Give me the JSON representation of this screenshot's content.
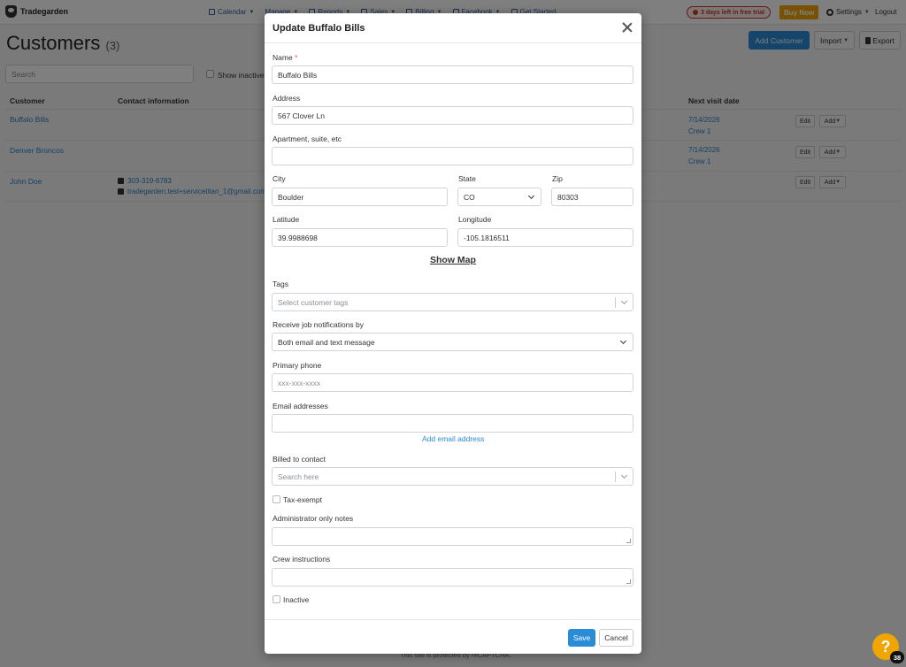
{
  "app": {
    "brand": "Tradegarden",
    "nav": [
      {
        "label": "Calendar"
      },
      {
        "label": "Manage"
      },
      {
        "label": "Reports"
      },
      {
        "label": "Sales"
      },
      {
        "label": "Billing"
      },
      {
        "label": "Facebook"
      },
      {
        "label": "Get Started"
      }
    ],
    "trial_badge": "3 days left in free trial",
    "buy_now": "Buy Now",
    "settings": "Settings",
    "logout": "Logout"
  },
  "page": {
    "title": "Customers",
    "count": "(3)",
    "add_customer": "Add Customer",
    "import": "Import",
    "export": "Export",
    "search_placeholder": "Search",
    "show_inactive": "Show inactive",
    "columns": {
      "customer": "Customer",
      "contact": "Contact information",
      "next_visit": "Next visit date"
    },
    "rows": [
      {
        "name": "Buffalo Bills",
        "phone": "",
        "email": "",
        "visit_date": "7/14/2026",
        "crew": "Crew 1"
      },
      {
        "name": "Denver Broncos",
        "phone": "",
        "email": "",
        "visit_date": "7/14/2026",
        "crew": "Crew 1"
      },
      {
        "name": "John Doe",
        "phone": "303-319-6783",
        "email": "tradegarden.test+servicetitan_1@gmail.com",
        "visit_date": "",
        "crew": ""
      }
    ],
    "row_edit": "Edit",
    "row_add": "Add",
    "recaptcha": "This site is protected by reCAPTCHA.",
    "help_badge": "38"
  },
  "modal": {
    "title": "Update Buffalo Bills",
    "name_label": "Name",
    "name_required": "*",
    "name_value": "Buffalo Bills",
    "address_label": "Address",
    "address_value": "567 Clover Ln",
    "apt_label": "Apartment, suite, etc",
    "apt_value": "",
    "city_label": "City",
    "city_value": "Boulder",
    "state_label": "State",
    "state_value": "CO",
    "zip_label": "Zip",
    "zip_value": "80303",
    "lat_label": "Latitude",
    "lat_value": "39.9988698",
    "lng_label": "Longitude",
    "lng_value": "-105.1816511",
    "show_map": "Show Map",
    "tags_label": "Tags",
    "tags_placeholder": "Select customer tags",
    "notif_label": "Receive job notifications by",
    "notif_value": "Both email and text message",
    "phone_label": "Primary phone",
    "phone_placeholder": "xxx-xxx-xxxx",
    "email_label": "Email addresses",
    "add_email": "Add email address",
    "billed_label": "Billed to contact",
    "billed_placeholder": "Search here",
    "tax_exempt": "Tax-exempt",
    "admin_notes_label": "Administrator only notes",
    "crew_label": "Crew instructions",
    "inactive": "Inactive",
    "save": "Save",
    "cancel": "Cancel"
  }
}
